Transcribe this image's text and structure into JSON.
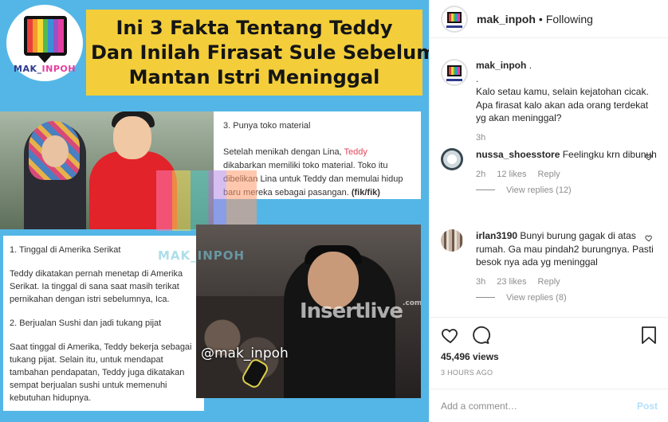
{
  "image": {
    "logo_text_a": "MAK_",
    "logo_text_b": "INPOH",
    "headline": [
      "Ini 3 Fakta Tentang Teddy",
      "Dan Inilah Firasat Sule Sebelum",
      "Mantan Istri Meninggal"
    ],
    "card3": {
      "title": "3. Punya toko material",
      "p1": "Setelah menikah dengan Lina, ",
      "p1_hl": "Teddy",
      "p2": " dikabarkan memiliki toko material. Toko itu dibelikan Lina untuk Teddy dan memulai hidup baru mereka sebagai pasangan. ",
      "tag": "(fik/fik)"
    },
    "card1": {
      "title1": "1. Tinggal di Amerika Serikat",
      "p1": "Teddy dikatakan pernah menetap di Amerika Serikat. Ia tinggal di sana saat masih terikat pernikahan dengan istri sebelumnya, Ica.",
      "title2": "2. Berjualan Sushi dan jadi tukang pijat",
      "p2": "Saat tinggal di Amerika, Teddy bekerja sebagai tukang pijat. Selain itu, untuk mendapat tambahan pendapatan, Teddy juga dikatakan sempat berjualan sushi untuk memenuhi kebutuhan hidupnya."
    },
    "watermark_insert": "Insertlive",
    "watermark_insert_com": ".com",
    "watermark_mak": "MAK_INPOH",
    "handle_overlay": "@mak_inpoh"
  },
  "header": {
    "username": "mak_inpoh",
    "dot": "•",
    "follow_status": "Following"
  },
  "comments": [
    {
      "username": "mak_inpoh",
      "text": " .\n.\nKalo setau kamu, selain kejatohan cicak. Apa firasat kalo akan ada orang terdekat yg akan meninggal?",
      "time": "3h"
    },
    {
      "username": "nussa_shoesstore",
      "text": " Feelingku krn dibunuh",
      "time": "2h",
      "likes": "12 likes",
      "reply": "Reply",
      "view_replies": "View replies (12)"
    },
    {
      "username": "irlan3190",
      "text": " Bunyi burung gagak di atas rumah. Ga mau pindah2 burungnya. Pasti besok nya ada yg meninggal",
      "time": "3h",
      "likes": "23 likes",
      "reply": "Reply",
      "view_replies": "View replies (8)"
    }
  ],
  "actions": {
    "views": "45,496 views",
    "time_ago": "3 HOURS AGO",
    "comment_placeholder": "Add a comment…",
    "post_label": "Post"
  },
  "colors": {
    "image_bg": "#54b6e6",
    "headline_bg": "#f3ce3a",
    "link_blue": "#b2dffc",
    "logo_stripes": [
      "#e8403c",
      "#f39a2b",
      "#f5d83a",
      "#52b94e",
      "#3a8fd8",
      "#9b4fc6",
      "#e63ea0"
    ]
  },
  "icons": [
    "heart-icon",
    "comment-icon",
    "bookmark-icon",
    "like-comment-heart-icon"
  ]
}
